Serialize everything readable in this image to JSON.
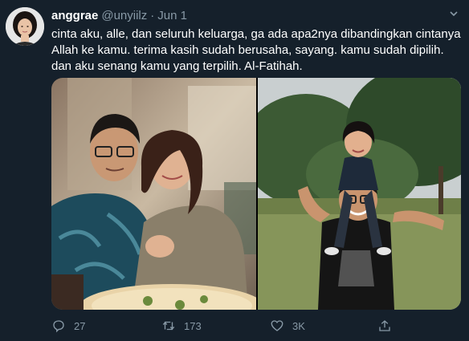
{
  "tweet": {
    "display_name": "anggrae",
    "handle": "@unyiilz",
    "separator": "·",
    "date": "Jun 1",
    "text": "cinta aku, alle, dan seluruh keluarga, ga ada apa2nya dibandingkan cintanya Allah ke kamu. terima kasih sudah berusaha, sayang. kamu sudah dipilih. dan aku senang kamu yang terpilih. Al-Fatihah."
  },
  "icons": {
    "caret": "chevron-down-icon",
    "reply": "reply-icon",
    "retweet": "retweet-icon",
    "like": "heart-icon",
    "share": "share-icon"
  },
  "actions": {
    "reply_count": "27",
    "retweet_count": "173",
    "like_count": "3K"
  },
  "colors": {
    "background": "#15202b",
    "secondary_text": "#8899a6",
    "primary_text": "#ffffff"
  }
}
